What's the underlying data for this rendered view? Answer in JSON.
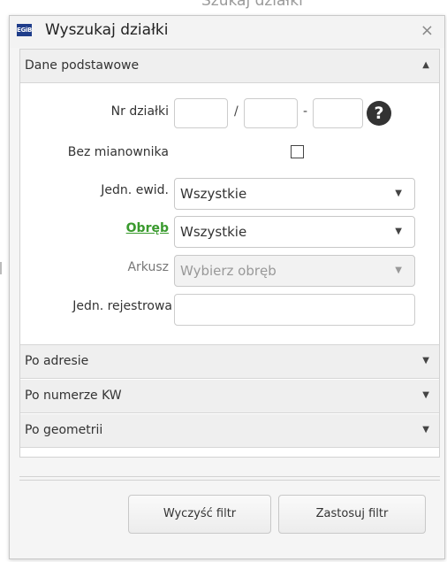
{
  "background": {
    "title_fragment": "Szukaj działki"
  },
  "dialog": {
    "logo_text": "EGiB",
    "title": "Wyszukaj działki",
    "close_glyph": "×"
  },
  "sections": {
    "basic": {
      "label": "Dane podstawowe",
      "arrow": "▲",
      "fields": {
        "nr_dzialki_label": "Nr działki",
        "sep_slash": "/",
        "sep_dash": "-",
        "help_glyph": "?",
        "bez_mianownika_label": "Bez mianownika",
        "jedn_ewid_label": "Jedn. ewid.",
        "jedn_ewid_value": "Wszystkie",
        "obreb_label": "Obręb",
        "obreb_value": "Wszystkie",
        "arkusz_label": "Arkusz",
        "arkusz_value": "Wybierz obręb",
        "jedn_rej_label": "Jedn. rejestrowa",
        "select_arrow": "▼"
      }
    },
    "address": {
      "label": "Po adresie",
      "arrow": "▼"
    },
    "kw": {
      "label": "Po numerze KW",
      "arrow": "▼"
    },
    "geometry": {
      "label": "Po geometrii",
      "arrow": "▼"
    }
  },
  "buttons": {
    "clear": "Wyczyść filtr",
    "apply": "Zastosuj filtr"
  },
  "colors": {
    "link_green": "#3a9a2e",
    "logo_blue": "#1f3d8a"
  }
}
